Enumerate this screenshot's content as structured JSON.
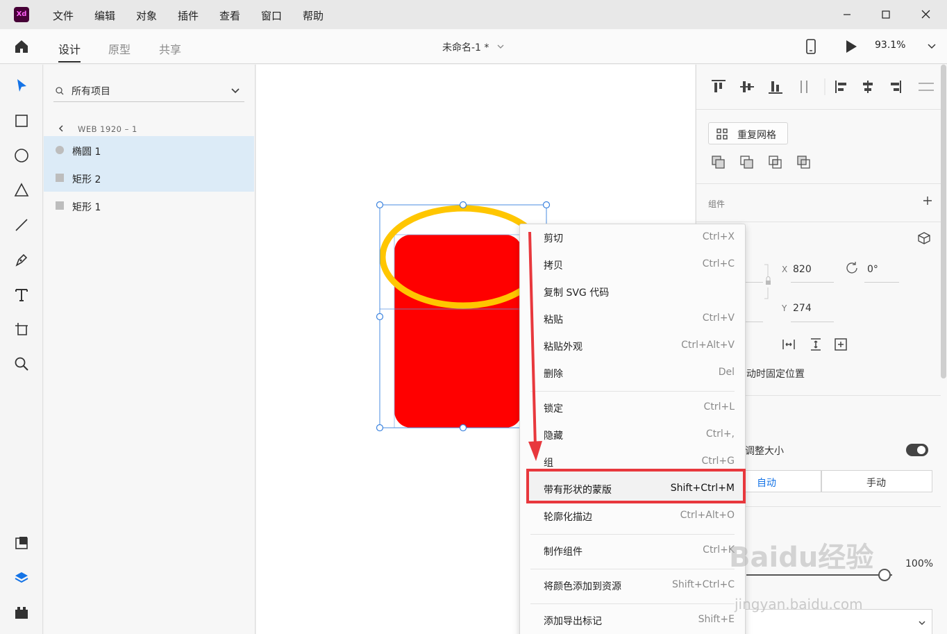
{
  "app": {
    "logo": "Xd"
  },
  "menubar": [
    "文件",
    "编辑",
    "对象",
    "插件",
    "查看",
    "窗口",
    "帮助"
  ],
  "tabs": [
    {
      "label": "设计",
      "active": true
    },
    {
      "label": "原型",
      "active": false
    },
    {
      "label": "共享",
      "active": false
    }
  ],
  "document": {
    "title": "未命名-1 *"
  },
  "zoom": {
    "value": "93.1%"
  },
  "layers": {
    "search_label": "所有项目",
    "breadcrumb": "WEB 1920 – 1",
    "items": [
      {
        "label": "椭圆 1",
        "selected": true,
        "shape": "circle"
      },
      {
        "label": "矩形 2",
        "selected": true,
        "shape": "square"
      },
      {
        "label": "矩形 1",
        "selected": false,
        "shape": "square"
      }
    ]
  },
  "props": {
    "repeat_grid_label": "重复网格",
    "component_label": "组件",
    "x_label": "X",
    "x_value": "820",
    "y_label": "Y",
    "y_value": "274",
    "rotation_value": "0°",
    "pin_text": "动时固定位置",
    "resize_text": "调整大小",
    "auto_label": "自动",
    "manual_label": "手动",
    "opacity_value": "100%"
  },
  "context_menu": {
    "items": [
      {
        "label": "剪切",
        "shortcut": "Ctrl+X"
      },
      {
        "label": "拷贝",
        "shortcut": "Ctrl+C"
      },
      {
        "label": "复制 SVG 代码",
        "shortcut": ""
      },
      {
        "label": "粘贴",
        "shortcut": "Ctrl+V"
      },
      {
        "label": "粘贴外观",
        "shortcut": "Ctrl+Alt+V"
      },
      {
        "label": "删除",
        "shortcut": "Del"
      },
      {
        "label": "锁定",
        "shortcut": "Ctrl+L"
      },
      {
        "label": "隐藏",
        "shortcut": "Ctrl+,"
      },
      {
        "label": "组",
        "shortcut": "Ctrl+G"
      },
      {
        "label": "带有形状的蒙版",
        "shortcut": "Shift+Ctrl+M",
        "highlighted": true
      },
      {
        "label": "轮廓化描边",
        "shortcut": "Ctrl+Alt+O"
      },
      {
        "label": "制作组件",
        "shortcut": "Ctrl+K"
      },
      {
        "label": "将颜色添加到资源",
        "shortcut": "Shift+Ctrl+C"
      },
      {
        "label": "添加导出标记",
        "shortcut": "Shift+E"
      }
    ]
  },
  "watermark": {
    "main": "Baidu经验",
    "sub": "jingyan.baidu.com"
  },
  "colors": {
    "accent": "#1473e6",
    "highlight": "#e8383d",
    "shape_fill": "#ff0000",
    "ellipse_stroke": "#ffc600"
  }
}
